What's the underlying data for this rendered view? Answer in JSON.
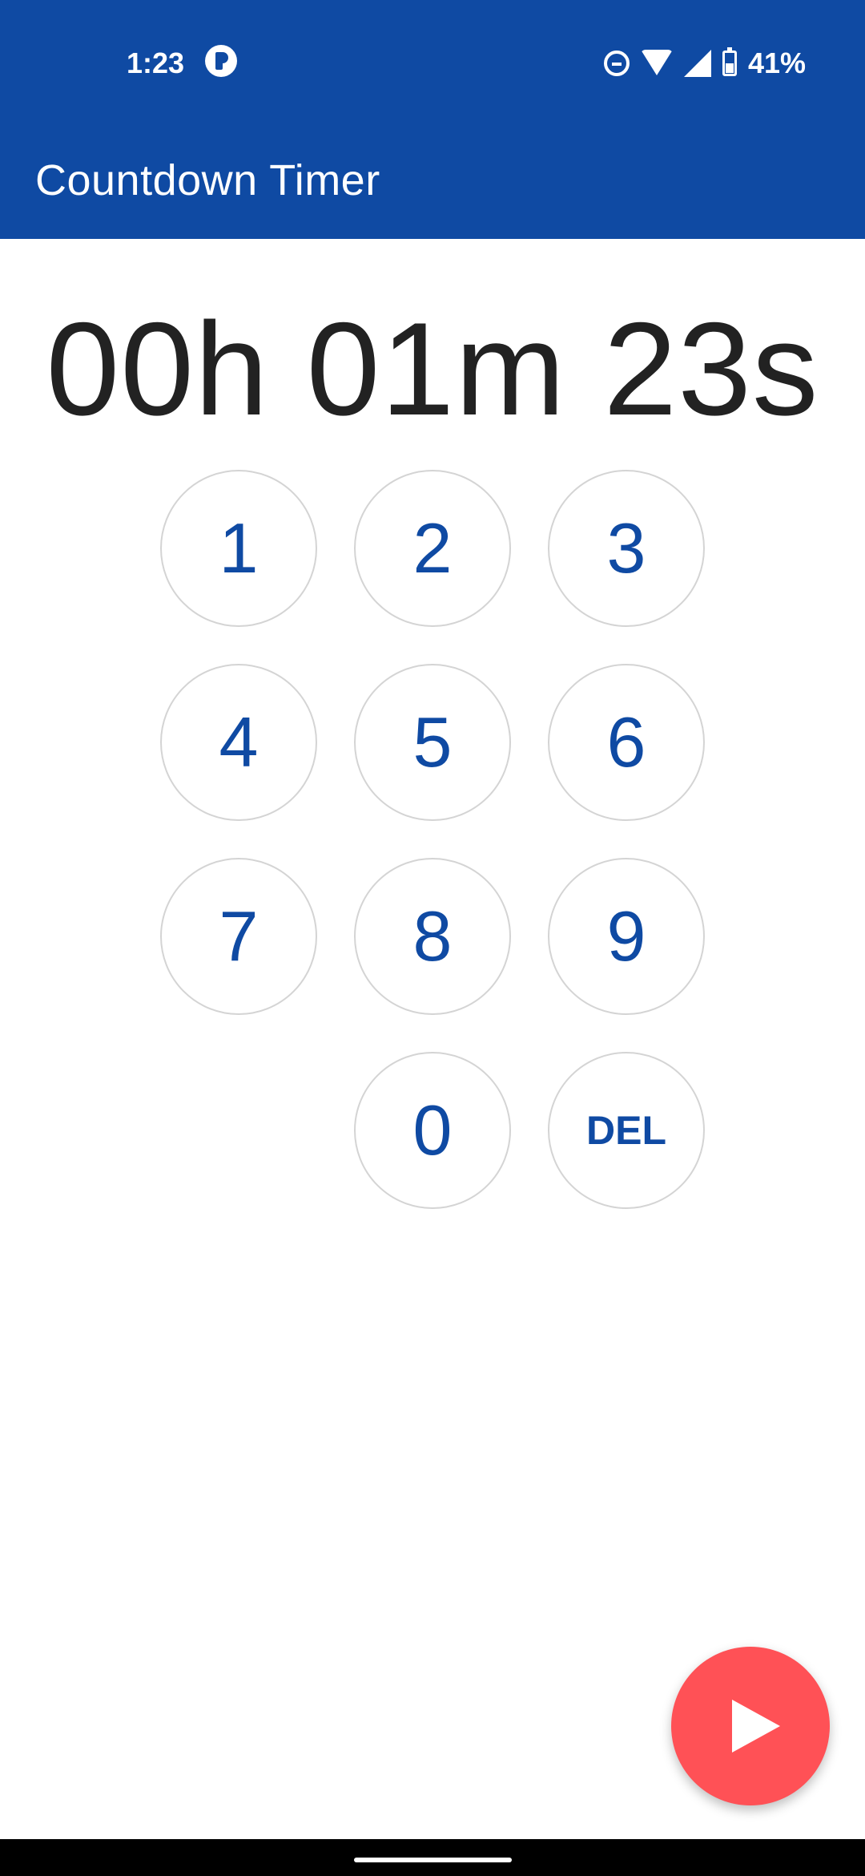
{
  "status_bar": {
    "time": "1:23",
    "battery": "41%",
    "icons": [
      "app-notification-icon",
      "do-not-disturb-icon",
      "wifi-icon",
      "cell-signal-icon",
      "battery-icon"
    ]
  },
  "app_bar": {
    "title": "Countdown Timer"
  },
  "timer": {
    "display": "00h 01m 23s"
  },
  "keypad": {
    "keys": [
      "1",
      "2",
      "3",
      "4",
      "5",
      "6",
      "7",
      "8",
      "9",
      "0",
      "DEL"
    ]
  },
  "fab": {
    "icon": "play-icon"
  },
  "colors": {
    "primary": "#0f4aa3",
    "accent": "#ff5156",
    "key_border": "#d4d4d4",
    "text_dark": "#222222"
  }
}
